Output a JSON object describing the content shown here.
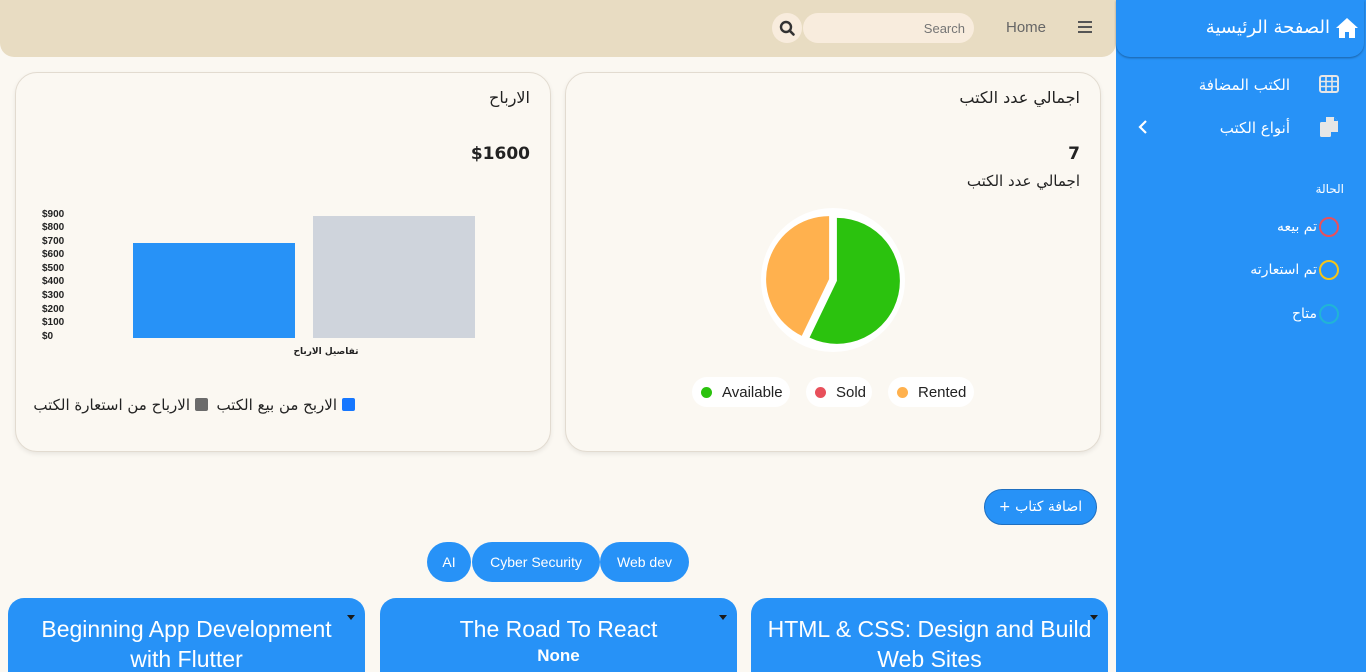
{
  "topbar": {
    "home_label": "Home",
    "search_placeholder": "Search",
    "menu_icon": "hamburger-icon",
    "search_icon": "search-icon"
  },
  "sidebar": {
    "title": "الصفحة الرئيسية",
    "items": [
      {
        "label": "الكتب المضافة",
        "icon": "grid-icon"
      },
      {
        "label": "أنواع الكتب",
        "icon": "copy-icon"
      }
    ],
    "status_section_label": "الحالة",
    "statuses": [
      {
        "label": "تم بيعه",
        "color": "#e8505b"
      },
      {
        "label": "تم استعارته",
        "color": "#f5c518"
      },
      {
        "label": "متاح",
        "color": "#21b4d6"
      }
    ]
  },
  "profits_card": {
    "title": "الارباح",
    "value": "$1600",
    "legend": [
      {
        "label": "الاربح من بيع الكتب",
        "color": "#1677ff"
      },
      {
        "label": "الارباح من استعارة الكتب",
        "color": "#6b6b6b"
      }
    ]
  },
  "books_card": {
    "title": "اجمالي عدد الكتب",
    "value": "7",
    "subtitle": "اجمالي عدد الكتب"
  },
  "chart_data": [
    {
      "type": "bar",
      "xlabel": "تفاصيل الارباح",
      "y_ticks": [
        "$900",
        "$800",
        "$700",
        "$600",
        "$500",
        "$400",
        "$300",
        "$200",
        "$100",
        "$0"
      ],
      "ylim": [
        0,
        900
      ],
      "series": [
        {
          "name": "الاربح من بيع الكتب",
          "value": 700,
          "color": "#2792f7"
        },
        {
          "name": "الارباح من استعارة الكتب",
          "value": 900,
          "color": "#cfd4dc"
        }
      ]
    },
    {
      "type": "pie",
      "series": [
        {
          "name": "Available",
          "value": 4,
          "color": "#2bc20e"
        },
        {
          "name": "Sold",
          "value": 0,
          "color": "#e8505b"
        },
        {
          "name": "Rented",
          "value": 3,
          "color": "#ffb14e"
        }
      ]
    }
  ],
  "add_book_label": "+ اضافة كتاب",
  "filters": [
    {
      "label": "AI"
    },
    {
      "label": "Cyber Security"
    },
    {
      "label": "Web dev"
    }
  ],
  "books": [
    {
      "title": "Beginning App Development with Flutter",
      "subtitle": ""
    },
    {
      "title": "The Road To React",
      "subtitle": "None"
    },
    {
      "title": "HTML & CSS: Design and Build Web Sites",
      "subtitle": ""
    }
  ]
}
